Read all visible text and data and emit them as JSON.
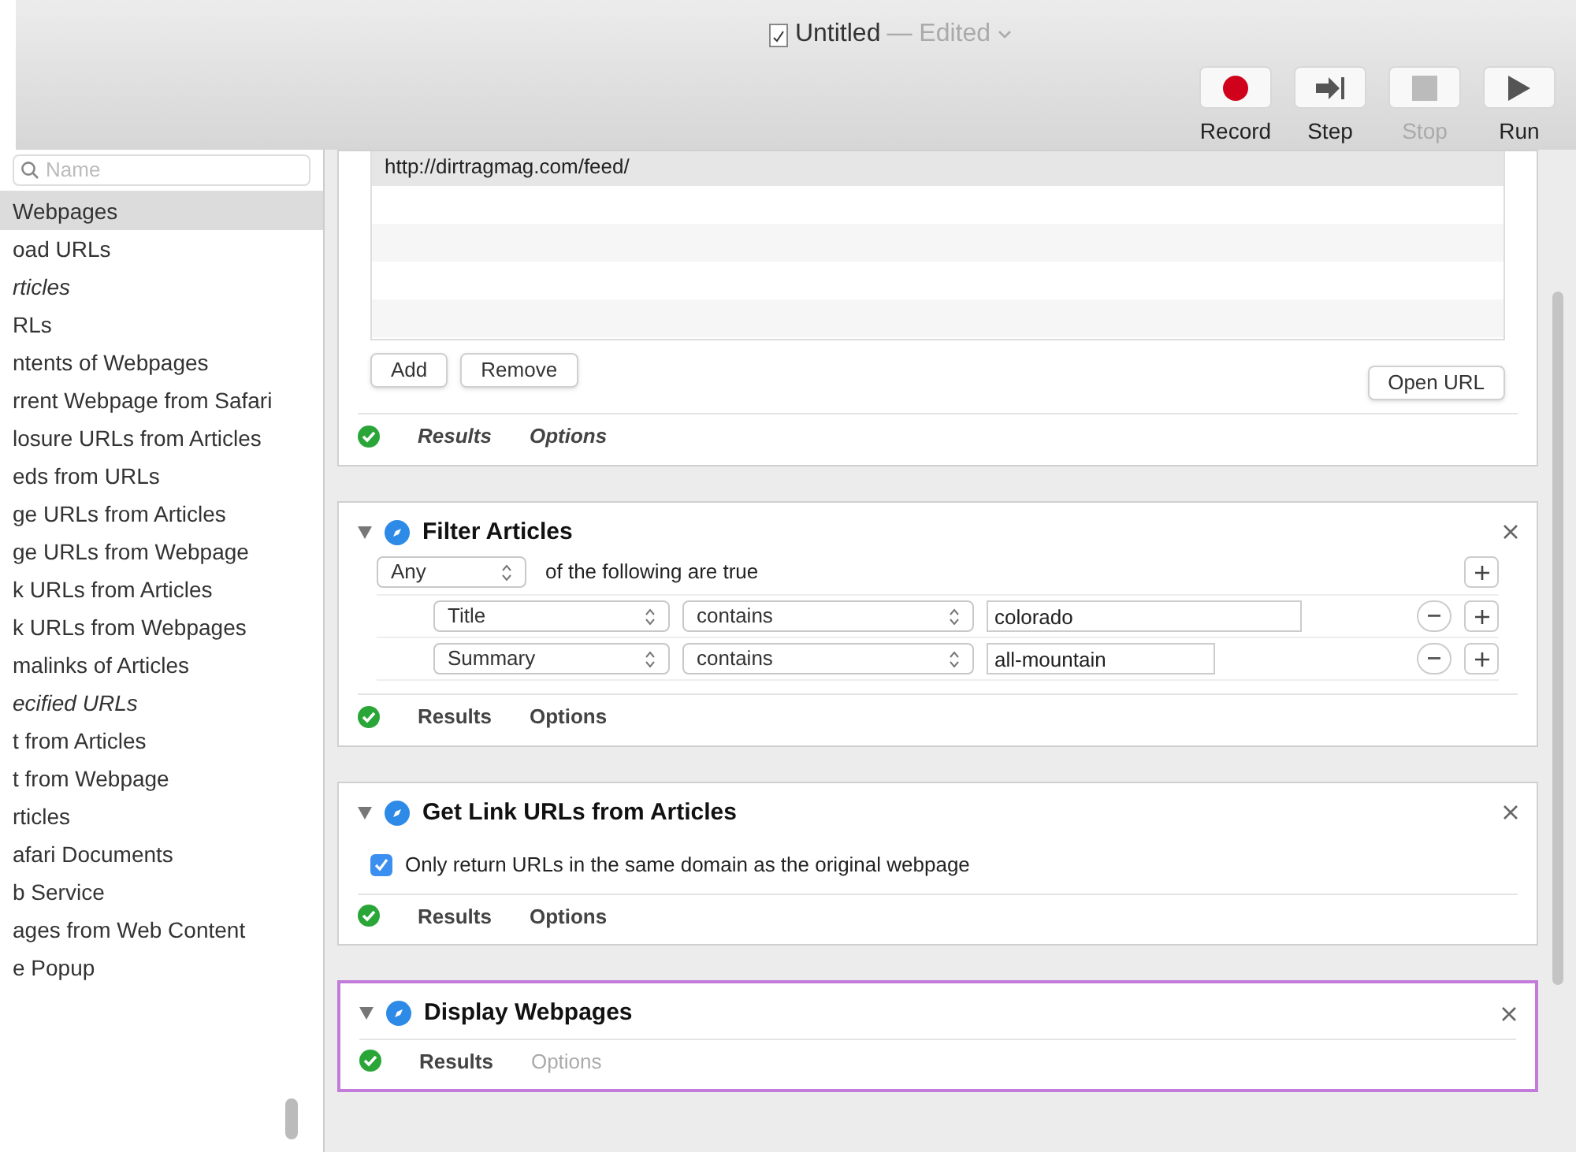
{
  "window": {
    "title": "Untitled",
    "status": "— Edited"
  },
  "toolbar": [
    {
      "label": "Record",
      "kind": "record",
      "disabled": false
    },
    {
      "label": "Step",
      "kind": "step",
      "disabled": false
    },
    {
      "label": "Stop",
      "kind": "stop",
      "disabled": true
    },
    {
      "label": "Run",
      "kind": "run",
      "disabled": false
    }
  ],
  "library": {
    "search": {
      "placeholder": "Name"
    },
    "items": [
      {
        "label": "Webpages",
        "selected": true,
        "italic": false
      },
      {
        "label": "oad URLs",
        "selected": false,
        "italic": false
      },
      {
        "label": "rticles",
        "selected": false,
        "italic": true
      },
      {
        "label": "RLs",
        "selected": false,
        "italic": false
      },
      {
        "label": "ntents of Webpages",
        "selected": false,
        "italic": false
      },
      {
        "label": "rrent Webpage from Safari",
        "selected": false,
        "italic": false
      },
      {
        "label": "losure URLs from Articles",
        "selected": false,
        "italic": false
      },
      {
        "label": "eds from URLs",
        "selected": false,
        "italic": false
      },
      {
        "label": "ge URLs from Articles",
        "selected": false,
        "italic": false
      },
      {
        "label": "ge URLs from Webpage",
        "selected": false,
        "italic": false
      },
      {
        "label": "k URLs from Articles",
        "selected": false,
        "italic": false
      },
      {
        "label": "k URLs from Webpages",
        "selected": false,
        "italic": false
      },
      {
        "label": "malinks of Articles",
        "selected": false,
        "italic": false
      },
      {
        "label": "ecified URLs",
        "selected": false,
        "italic": true
      },
      {
        "label": "t from Articles",
        "selected": false,
        "italic": false
      },
      {
        "label": "t from Webpage",
        "selected": false,
        "italic": false
      },
      {
        "label": "rticles",
        "selected": false,
        "italic": false
      },
      {
        "label": "afari Documents",
        "selected": false,
        "italic": false
      },
      {
        "label": "b Service",
        "selected": false,
        "italic": false
      },
      {
        "label": "ages from Web Content",
        "selected": false,
        "italic": false
      },
      {
        "label": "e Popup",
        "selected": false,
        "italic": false
      }
    ]
  },
  "workflow": [
    {
      "kind": "url_list",
      "selected": false,
      "urls": [
        "http://dirtragmag.com/feed/"
      ],
      "buttons": [
        "Add",
        "Remove"
      ],
      "open_button": "Open URL",
      "results": "Results",
      "options": "Options",
      "options_enabled": true
    },
    {
      "kind": "filter",
      "title": "Filter Articles",
      "selected": false,
      "match": "Any",
      "match_text": "of the following are true",
      "rules": [
        {
          "field": "Title",
          "operator": "contains",
          "value": "colorado"
        },
        {
          "field": "Summary",
          "operator": "contains",
          "value": "all-mountain"
        }
      ],
      "results": "Results",
      "options": "Options",
      "options_enabled": true
    },
    {
      "kind": "checkbox",
      "title": "Get Link URLs from Articles",
      "selected": false,
      "checkbox": {
        "label": "Only return URLs in the same domain as the original webpage",
        "checked": true
      },
      "results": "Results",
      "options": "Options",
      "options_enabled": true
    },
    {
      "kind": "plain",
      "title": "Display Webpages",
      "selected": true,
      "results": "Results",
      "options": "Options",
      "options_enabled": false
    }
  ]
}
